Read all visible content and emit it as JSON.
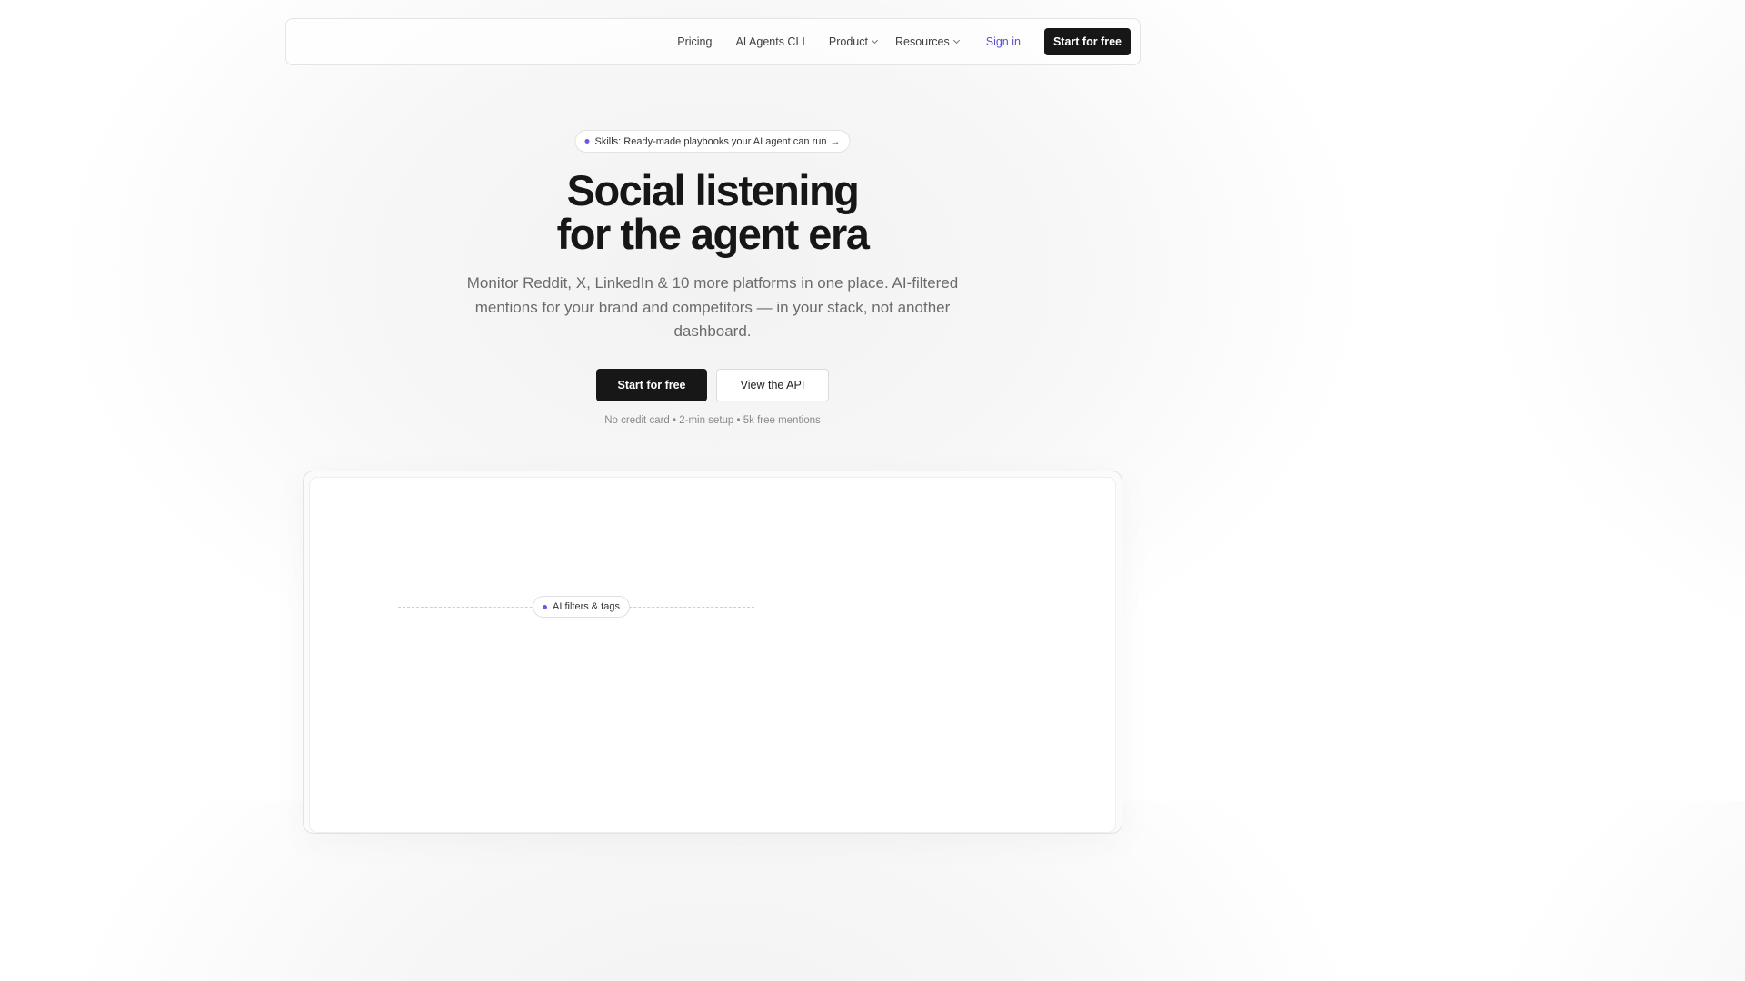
{
  "nav": {
    "links": [
      {
        "label": "Pricing"
      },
      {
        "label": "AI Agents CLI"
      },
      {
        "label": "Product"
      },
      {
        "label": "Resources"
      }
    ],
    "sign_in": "Sign in",
    "cta": "Start for free"
  },
  "announcement": {
    "text": "Skills: Ready-made playbooks your AI agent can run",
    "arrow": "→"
  },
  "hero": {
    "title_line1": "Social listening",
    "title_line2": "for the agent era",
    "subtitle": "Monitor Reddit, X, LinkedIn & 10 more platforms in one place. AI-filtered mentions for your brand and competitors — in your stack, not another dashboard.",
    "primary_cta": "Start for free",
    "secondary_cta": "View the API",
    "fine_print": "No credit card • 2-min setup • 5k free mentions"
  },
  "demo": {
    "filter_label": "AI filters & tags"
  },
  "colors": {
    "accent": "#6a5ae0",
    "link": "#5b4fd1",
    "dark": "#171717"
  }
}
